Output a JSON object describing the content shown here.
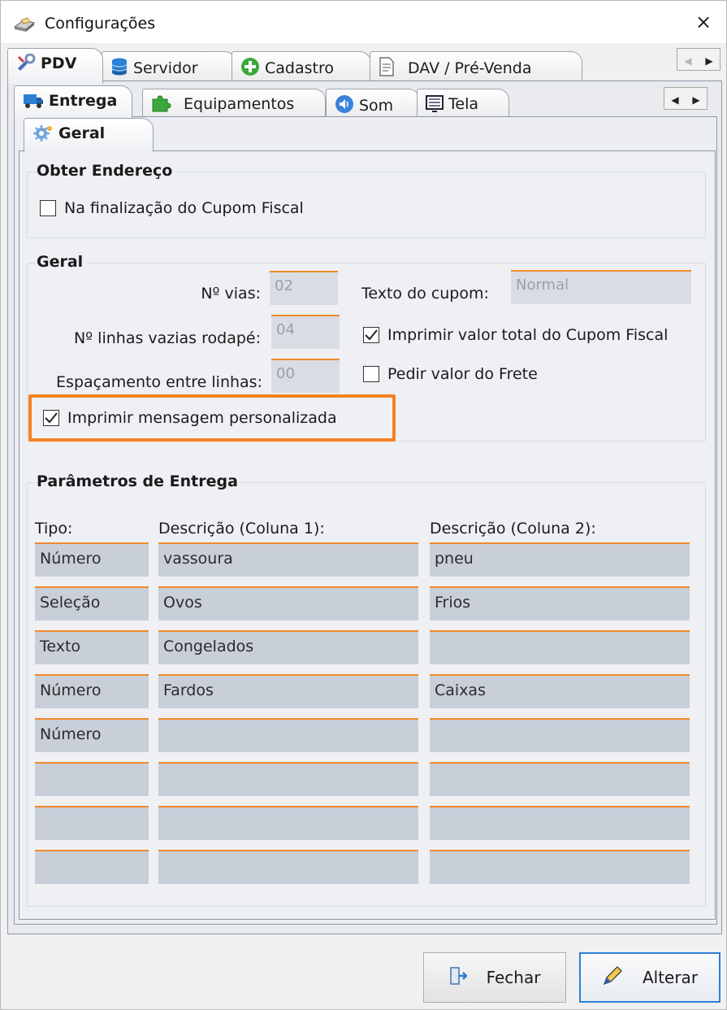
{
  "window": {
    "title": "Configurações",
    "close_label": "×"
  },
  "main_tabs": [
    {
      "label": "PDV",
      "icon": "wrench-icon"
    },
    {
      "label": "Servidor",
      "icon": "database-icon"
    },
    {
      "label": "Cadastro",
      "icon": "plus-circle-icon"
    },
    {
      "label": "DAV / Pré-Venda",
      "icon": "document-icon"
    }
  ],
  "sub_tabs": [
    {
      "label": "Entrega",
      "icon": "truck-icon"
    },
    {
      "label": "Equipamentos",
      "icon": "puzzle-icon"
    },
    {
      "label": "Som",
      "icon": "speaker-icon"
    },
    {
      "label": "Tela",
      "icon": "screen-icon"
    }
  ],
  "inner_tab": {
    "label": "Geral",
    "icon": "gear-icon"
  },
  "scroll_arrows": {
    "left": "◀",
    "right": "▶"
  },
  "obter_endereco": {
    "title": "Obter Endereço",
    "na_finalizacao": {
      "label": "Na finalização do Cupom Fiscal",
      "checked": false
    }
  },
  "geral": {
    "title": "Geral",
    "n_vias": {
      "label": "Nº vias:",
      "value": "02"
    },
    "n_linhas": {
      "label": "Nº linhas vazias rodapé:",
      "value": "04"
    },
    "espacamento": {
      "label": "Espaçamento entre linhas:",
      "value": "00"
    },
    "texto_cupom": {
      "label": "Texto do cupom:",
      "value": "Normal"
    },
    "imprimir_valor_total": {
      "label": "Imprimir valor total do Cupom Fiscal",
      "checked": true
    },
    "pedir_frete": {
      "label": "Pedir valor do Frete",
      "checked": false
    },
    "imprimir_mensagem": {
      "label": "Imprimir mensagem personalizada",
      "checked": true
    }
  },
  "parametros": {
    "title": "Parâmetros de Entrega",
    "headers": {
      "tipo": "Tipo:",
      "desc1": "Descrição (Coluna 1):",
      "desc2": "Descrição (Coluna 2):"
    },
    "rows": [
      {
        "tipo": "Número",
        "desc1": "vassoura",
        "desc2": "pneu"
      },
      {
        "tipo": "Seleção",
        "desc1": "Ovos",
        "desc2": "Frios"
      },
      {
        "tipo": "Texto",
        "desc1": "Congelados",
        "desc2": ""
      },
      {
        "tipo": "Número",
        "desc1": "Fardos",
        "desc2": "Caixas"
      },
      {
        "tipo": "Número",
        "desc1": "",
        "desc2": ""
      },
      {
        "tipo": "",
        "desc1": "",
        "desc2": ""
      },
      {
        "tipo": "",
        "desc1": "",
        "desc2": ""
      },
      {
        "tipo": "",
        "desc1": "",
        "desc2": ""
      }
    ]
  },
  "buttons": {
    "fechar": {
      "label": "Fechar",
      "icon": "exit-door-icon"
    },
    "alterar": {
      "label": "Alterar",
      "icon": "pencil-icon"
    }
  },
  "colors": {
    "accent": "#F58220",
    "field_line": "#F08A2C",
    "selected_border": "#2F7FD6"
  }
}
